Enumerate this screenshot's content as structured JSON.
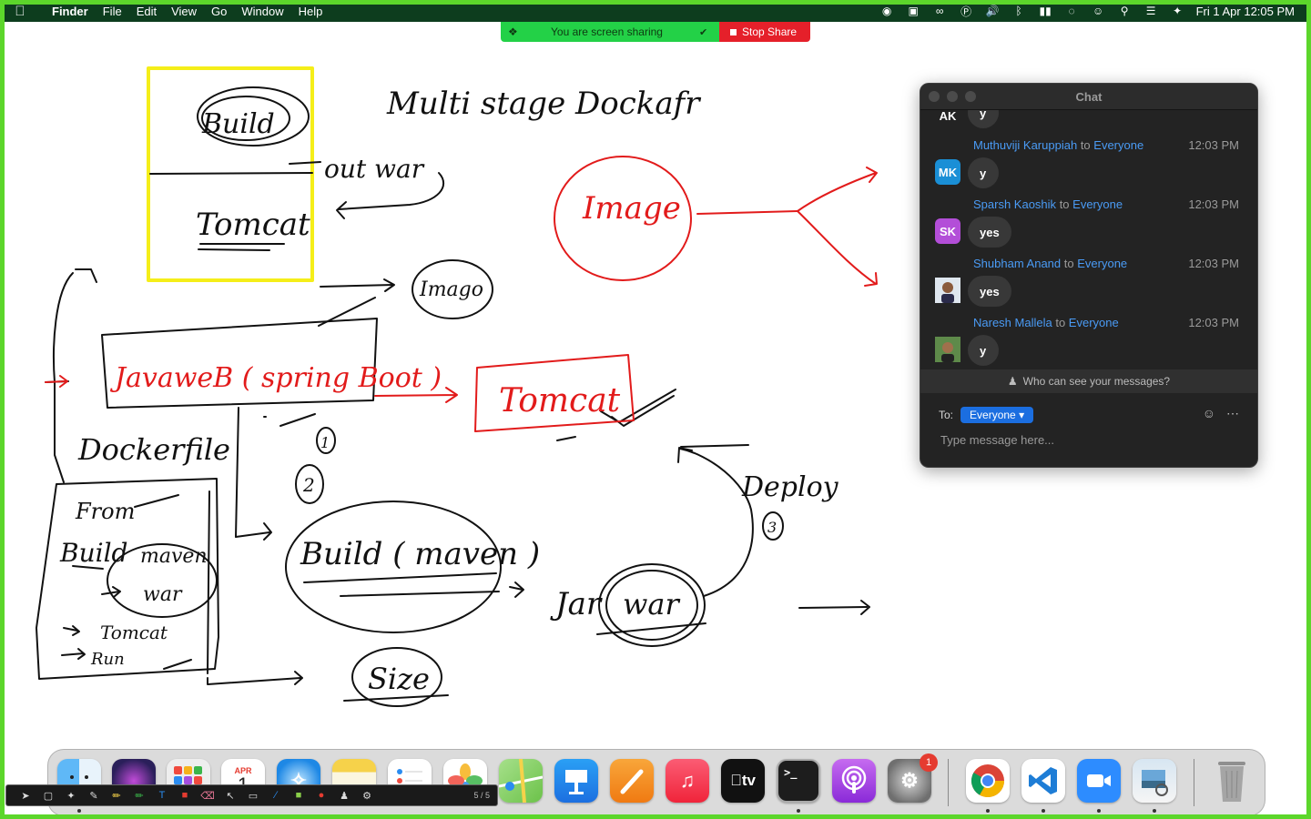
{
  "menubar": {
    "app_name": "Finder",
    "menus": [
      "File",
      "Edit",
      "View",
      "Go",
      "Window",
      "Help"
    ],
    "datetime": "Fri 1 Apr  12:05 PM",
    "status_icons": [
      "zoom-icon",
      "facetime-icon",
      "creative-cloud-icon",
      "accessibility-icon",
      "volume-icon",
      "bluetooth-icon",
      "battery-icon",
      "wifi-icon",
      "user-icon",
      "spotlight-icon",
      "control-center-icon",
      "siri-icon"
    ]
  },
  "share_bar": {
    "status_text": "You are screen sharing",
    "stop_label": "Stop Share",
    "colors": {
      "green": "#23d147",
      "red": "#e5202a"
    }
  },
  "whiteboard": {
    "heading": "Multi stage Dockafr",
    "labels": {
      "build_top": "Build",
      "tomcat_box": "Tomcat",
      "out_war": "out war",
      "image_red": "Image",
      "image_black": "Imago",
      "javaweb": "JavaweB ( spring Boot )",
      "tomcat_red": "Tomcat",
      "dockerfile": "Dockerfile",
      "num_1": "1",
      "num_2": "2",
      "num_3": "3",
      "from": "From",
      "build_side": "Build",
      "maven_side": "maven",
      "war_side": "war",
      "tomcat_side": "Tomcat",
      "run_side": "Run",
      "build_maven": "Build ( maven )",
      "jar": "Jar",
      "war_circle": "war",
      "deploy": "Deploy",
      "size": "Size"
    },
    "colors": {
      "ink": "#111111",
      "red": "#e21b1b",
      "highlight": "#f5ee19"
    }
  },
  "chat": {
    "title": "Chat",
    "partial": {
      "initials": "AK",
      "text": "y",
      "color": "#1fb55f"
    },
    "messages": [
      {
        "sender": "Muthuviji Karuppiah",
        "to_word": "to",
        "recipient": "Everyone",
        "time": "12:03 PM",
        "initials": "MK",
        "color": "#1a8fd6",
        "text": "y"
      },
      {
        "sender": "Sparsh Kaoshik",
        "to_word": "to",
        "recipient": "Everyone",
        "time": "12:03 PM",
        "initials": "SK",
        "color": "#b34ed8",
        "text": "yes"
      },
      {
        "sender": "Shubham Anand",
        "to_word": "to",
        "recipient": "Everyone",
        "time": "12:03 PM",
        "initials": "",
        "color": "#6b4a3a",
        "text": "yes"
      },
      {
        "sender": "Naresh Mallela",
        "to_word": "to",
        "recipient": "Everyone",
        "time": "12:03 PM",
        "initials": "",
        "color": "#3a6a3a",
        "text": "y"
      }
    ],
    "visibility_note": "Who can see your messages?",
    "to_label": "To:",
    "recipient_select": "Everyone",
    "placeholder": "Type message here..."
  },
  "dock": {
    "apps": [
      {
        "name": "Finder",
        "icon": "finder-icon",
        "color": "#1f8cf0"
      },
      {
        "name": "Siri",
        "icon": "siri-icon",
        "color": "#3b2a6b"
      },
      {
        "name": "Launchpad",
        "icon": "launchpad-icon",
        "color": "#e9e9e9"
      },
      {
        "name": "Calendar",
        "icon": "calendar-icon",
        "color": "#ffffff",
        "month": "APR",
        "day": "1"
      },
      {
        "name": "Safari",
        "icon": "safari-icon",
        "color": "#1e88e5"
      },
      {
        "name": "Notes",
        "icon": "notes-icon",
        "color": "#f6d24a"
      },
      {
        "name": "Reminders",
        "icon": "reminders-icon",
        "color": "#ffffff"
      },
      {
        "name": "Photos",
        "icon": "photos-icon",
        "color": "#ffffff"
      },
      {
        "name": "Maps",
        "icon": "maps-icon",
        "color": "#6cc24a"
      },
      {
        "name": "Keynote",
        "icon": "keynote-icon",
        "color": "#1c8ef0"
      },
      {
        "name": "Pages",
        "icon": "pages-icon",
        "color": "#f5931e"
      },
      {
        "name": "Music",
        "icon": "music-icon",
        "color": "#f33a4f"
      },
      {
        "name": "TV",
        "icon": "tv-icon",
        "color": "#111111",
        "label": "tv"
      },
      {
        "name": "Terminal",
        "icon": "terminal-icon",
        "color": "#1d1d1d"
      },
      {
        "name": "Podcasts",
        "icon": "podcasts-icon",
        "color": "#a13de0"
      },
      {
        "name": "System Preferences",
        "icon": "settings-icon",
        "color": "#8b8b8b",
        "badge": "1"
      },
      {
        "name": "Chrome",
        "icon": "chrome-icon",
        "color": "#ffffff"
      },
      {
        "name": "VS Code",
        "icon": "vscode-icon",
        "color": "#ffffff"
      },
      {
        "name": "Zoom",
        "icon": "zoom-app-icon",
        "color": "#2d8cff"
      },
      {
        "name": "Preview",
        "icon": "preview-icon",
        "color": "#e8eef5"
      },
      {
        "name": "Trash",
        "icon": "trash-icon",
        "color": "#a5a5a5"
      }
    ]
  },
  "annotation_toolbar": {
    "tools": [
      "mouse-tool",
      "select-tool",
      "spotlight-tool",
      "pen-tool",
      "highlighter-tool",
      "text-tool",
      "shape-tool",
      "eraser-tool",
      "pointer-tool",
      "rectangle-tool",
      "line-tool",
      "fill-tool",
      "color-tool",
      "stamp-tool",
      "settings-tool"
    ],
    "page_indicator": "5 / 5"
  }
}
